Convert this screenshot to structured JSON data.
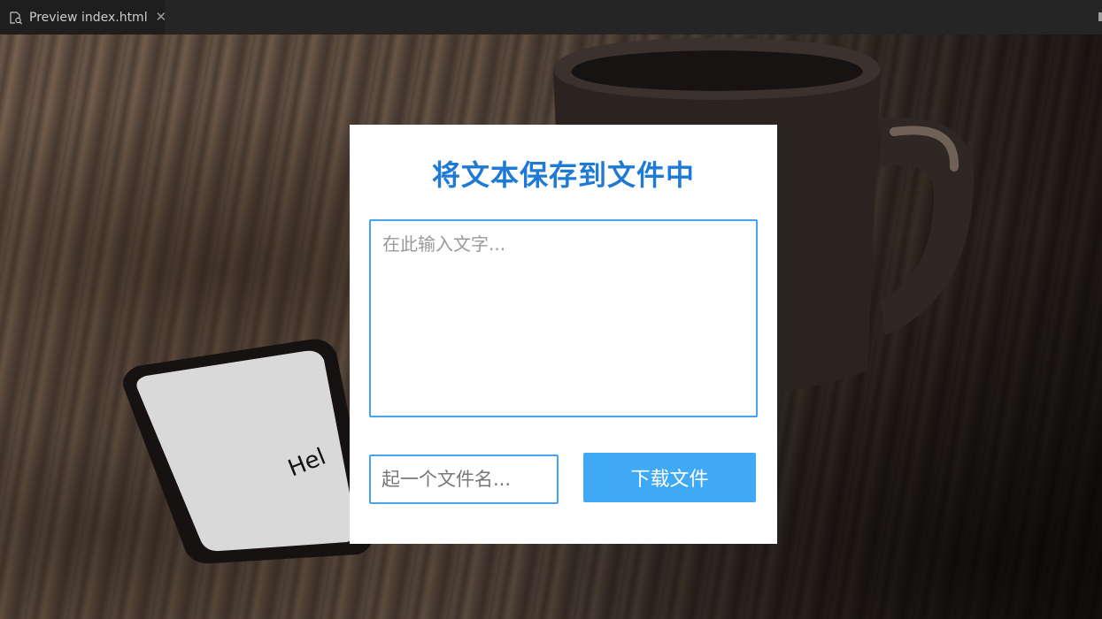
{
  "tab": {
    "title": "Preview index.html",
    "icon": "preview-icon",
    "close_glyph": "✕"
  },
  "form": {
    "heading": "将文本保存到文件中",
    "textarea_placeholder": "在此输入文字...",
    "filename_placeholder": "起一个文件名...",
    "download_label": "下载文件"
  },
  "colors": {
    "heading": "#1f7ad6",
    "accent_border": "#42a5f5",
    "button_bg": "#3fa9f5",
    "button_text": "#ffffff",
    "card_bg": "#ffffff"
  },
  "background": {
    "phone_screen_text": "Hel"
  }
}
